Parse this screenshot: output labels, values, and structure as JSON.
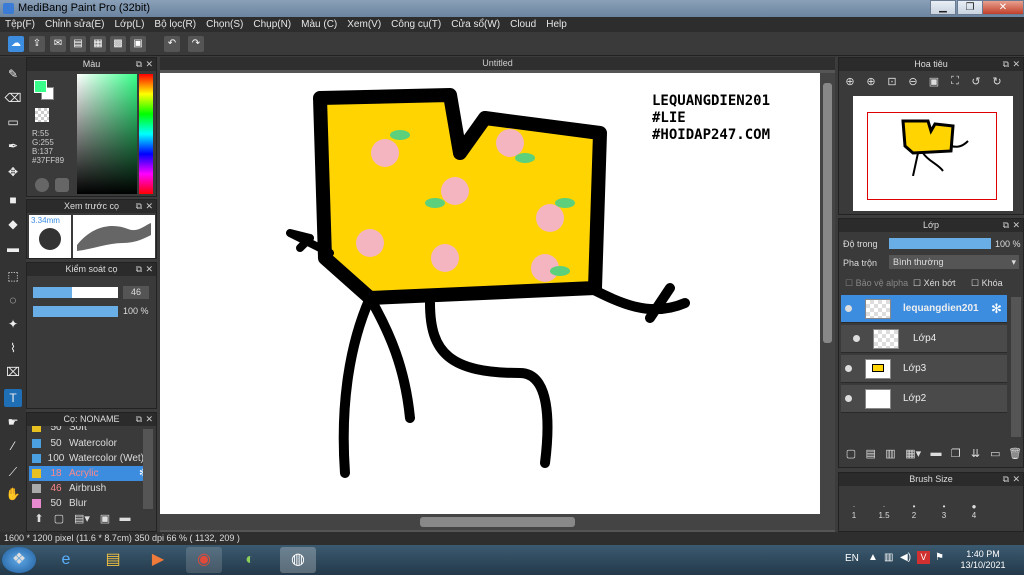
{
  "app": {
    "title": "MediBang Paint Pro (32bit)"
  },
  "menu": [
    "Tệp(F)",
    "Chỉnh sửa(E)",
    "Lớp(L)",
    "Bộ lọc(R)",
    "Chọn(S)",
    "Chụp(N)",
    "Màu (C)",
    "Xem(V)",
    "Công cụ(T)",
    "Cửa sổ(W)",
    "Cloud",
    "Help"
  ],
  "color_panel": {
    "title": "Màu",
    "r": "R:55",
    "g": "G:255",
    "b": "B:137",
    "hex": "#37FF89",
    "fg_color": "#37FF89",
    "bg_color": "#FFFFFF"
  },
  "brush_preview": {
    "title": "Xem trước cọ",
    "size": "3.34mm"
  },
  "brush_control": {
    "title": "Kiểm soát cọ",
    "size_value": "46",
    "opacity_value": "100 %",
    "size_fraction": 0.46,
    "opacity_fraction": 1.0
  },
  "brush_list": {
    "title": "Cọ: NONAME",
    "items": [
      {
        "size": "50",
        "name": "Soft",
        "color": "#e8c020",
        "selected": false
      },
      {
        "size": "50",
        "name": "Watercolor",
        "color": "#4aa0e0",
        "selected": false
      },
      {
        "size": "100",
        "name": "Watercolor (Wet)",
        "color": "#4aa0e0",
        "selected": false
      },
      {
        "size": "18",
        "name": "Acrylic",
        "color": "#e8c020",
        "selected": true
      },
      {
        "size": "46",
        "name": "Airbrush",
        "color": "#aaaaaa",
        "selected": false
      },
      {
        "size": "50",
        "name": "Blur",
        "color": "#e88ad0",
        "selected": false
      }
    ]
  },
  "canvas": {
    "tab_title": "Untitled",
    "watermark_lines": [
      "LEQUANGDIEN201",
      "#LIE",
      "#HOIDAP247.COM"
    ]
  },
  "navigator": {
    "title": "Hoa tiêu"
  },
  "layers": {
    "title": "Lớp",
    "opacity_label": "Độ trong",
    "opacity_value": "100 %",
    "opacity_fraction": 1.0,
    "blend_label": "Pha trộn",
    "blend_value": "Bình thường",
    "protect_alpha": "Bảo vệ alpha",
    "clipping": "Xén bớt",
    "lock": "Khóa",
    "items": [
      {
        "name": "lequangdien201",
        "selected": true
      },
      {
        "name": "Lớp4",
        "selected": false
      },
      {
        "name": "Lớp3",
        "selected": false
      },
      {
        "name": "Lớp2",
        "selected": false
      }
    ]
  },
  "brush_size": {
    "title": "Brush Size",
    "sizes": [
      "1",
      "1.5",
      "2",
      "3",
      "4"
    ]
  },
  "status": {
    "dimensions": "1600 * 1200 pixel",
    "physical": "(11.6 * 8.7cm)",
    "dpi": "350 dpi",
    "zoom": "66 %",
    "coords": "( 1132, 209 )"
  },
  "taskbar": {
    "lang": "EN",
    "time": "1:40 PM",
    "date": "13/10/2021"
  }
}
